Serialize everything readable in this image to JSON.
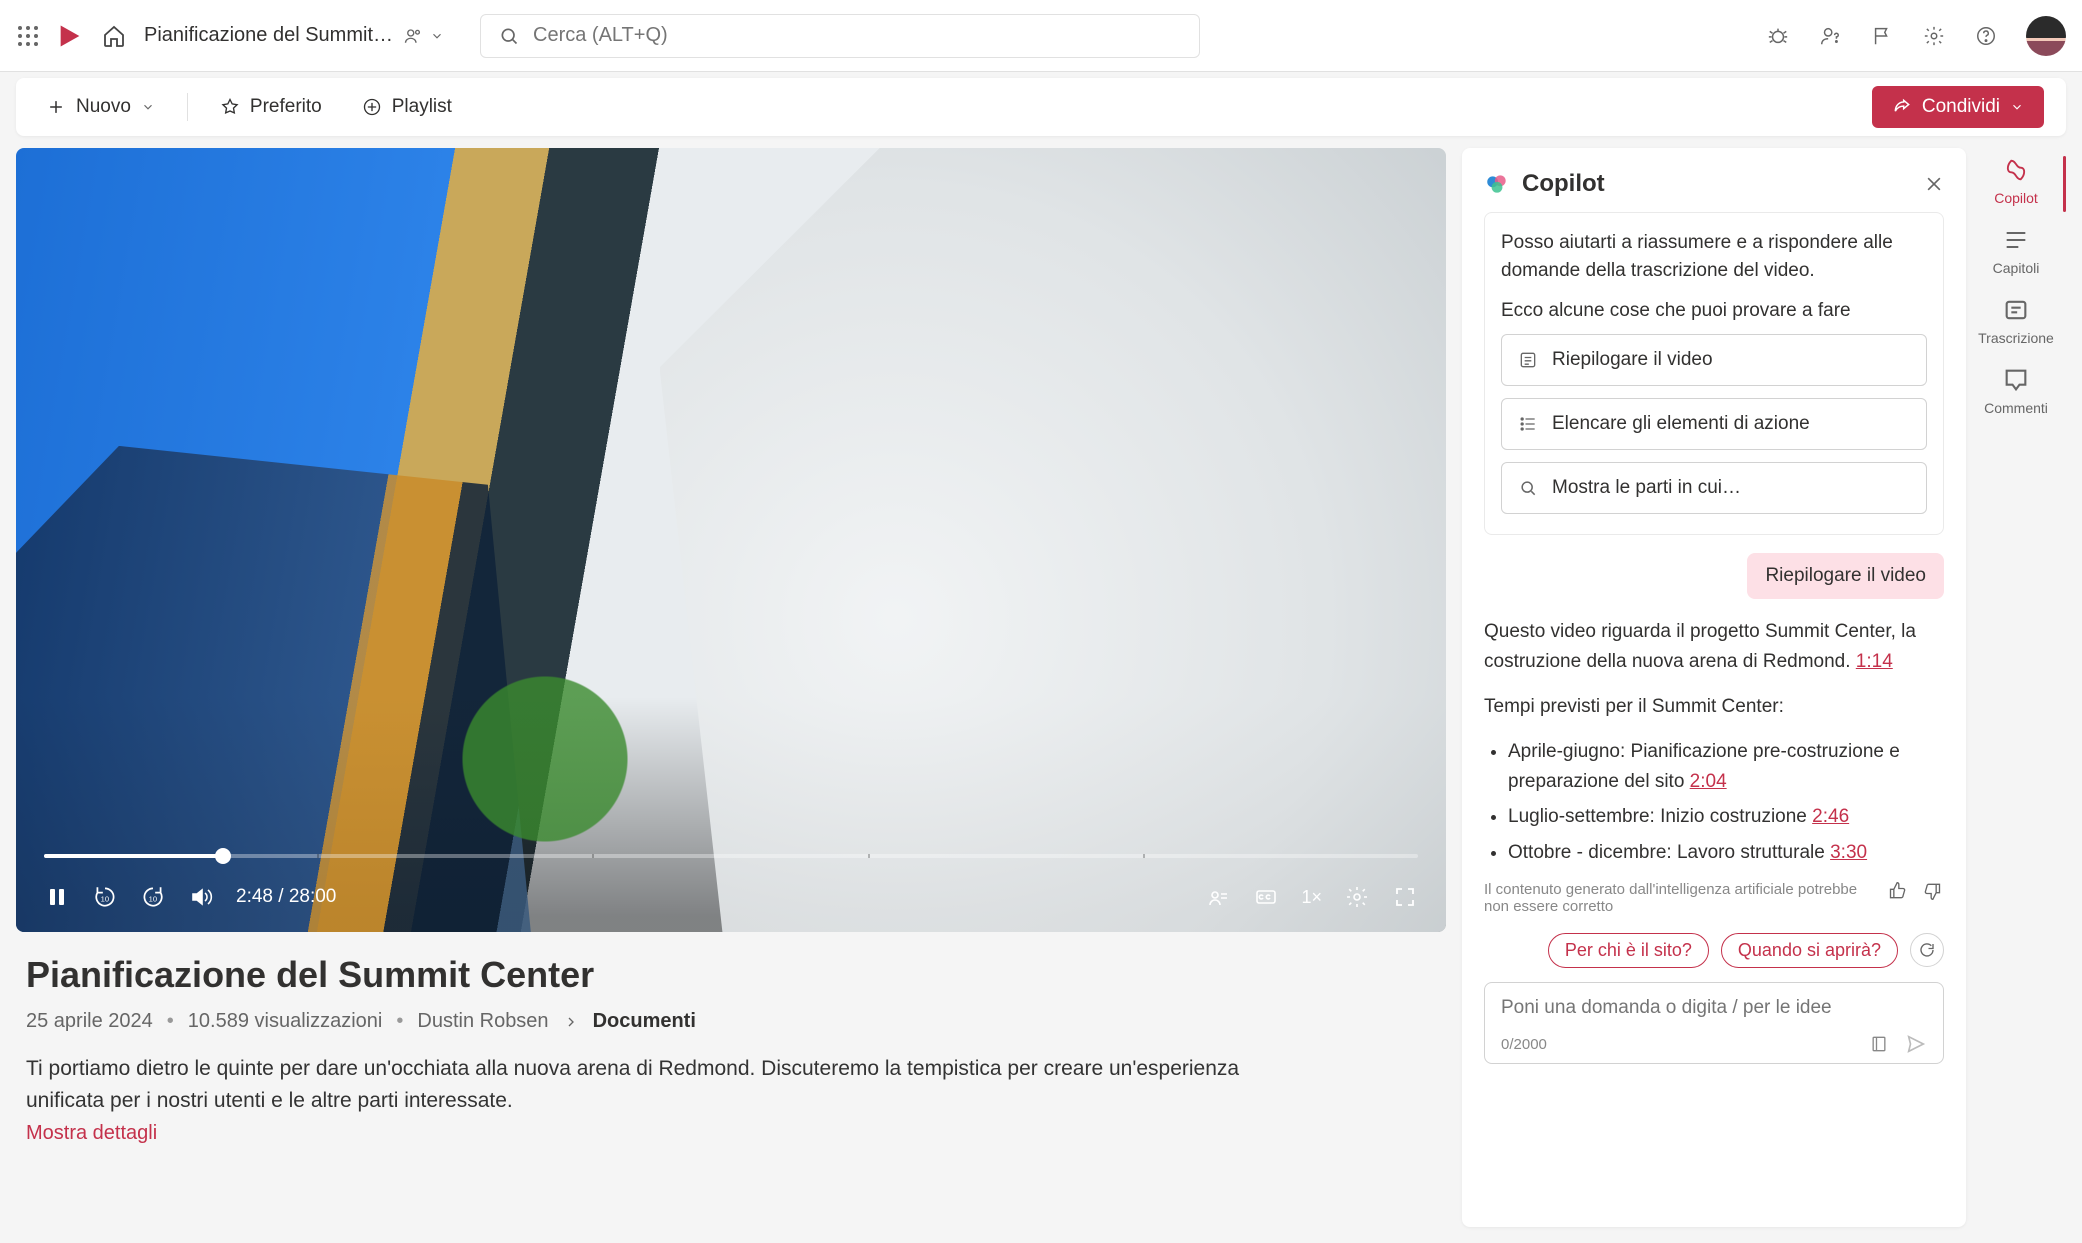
{
  "header": {
    "doc_title": "Pianificazione del Summit Center - S…",
    "search_placeholder": "Cerca (ALT+Q)"
  },
  "toolbar": {
    "new_label": "Nuovo",
    "favorite_label": "Preferito",
    "playlist_label": "Playlist",
    "share_label": "Condividi"
  },
  "video": {
    "time_current": "2:48",
    "time_total": "28:00",
    "rate": "1×",
    "title": "Pianificazione del Summit Center",
    "date": "25 aprile 2024",
    "views": "10.589 visualizzazioni",
    "owner": "Dustin Robsen",
    "breadcrumb_target": "Documenti",
    "description": "Ti portiamo dietro le quinte per dare un'occhiata alla nuova arena di Redmond. Discuteremo la tempistica per creare un'esperienza unificata per i nostri utenti e le altre parti interessate.",
    "show_more": "Mostra dettagli"
  },
  "copilot": {
    "title": "Copilot",
    "intro": "Posso aiutarti a riassumere e a rispondere alle domande della trascrizione del video.",
    "try_heading": "Ecco alcune cose che puoi provare a fare",
    "suggest1": "Riepilogare il video",
    "suggest2": "Elencare gli elementi di azione",
    "suggest3": "Mostra le parti in cui…",
    "user_message": "Riepilogare il video",
    "reply_p1_a": "Questo video riguarda il progetto Summit Center, la costruzione della nuova arena di Redmond. ",
    "reply_p1_ts": "1:14",
    "reply_p2_head": "Tempi previsti per il Summit Center:",
    "reply_items": [
      {
        "text": "Aprile-giugno: Pianificazione pre-costruzione e preparazione del sito ",
        "ts": "2:04"
      },
      {
        "text": "Luglio-settembre: Inizio costruzione ",
        "ts": "2:46"
      },
      {
        "text": "Ottobre - dicembre: Lavoro strutturale ",
        "ts": "3:30"
      }
    ],
    "disclaimer": "Il contenuto generato dall'intelligenza artificiale potrebbe non essere corretto",
    "chip1": "Per chi è il sito?",
    "chip2": "Quando si aprirà?",
    "input_placeholder": "Poni una domanda o digita / per le idee",
    "counter": "0/2000"
  },
  "rail": {
    "copilot": "Copilot",
    "chapters": "Capitoli",
    "transcript": "Trascrizione",
    "comments": "Commenti"
  }
}
